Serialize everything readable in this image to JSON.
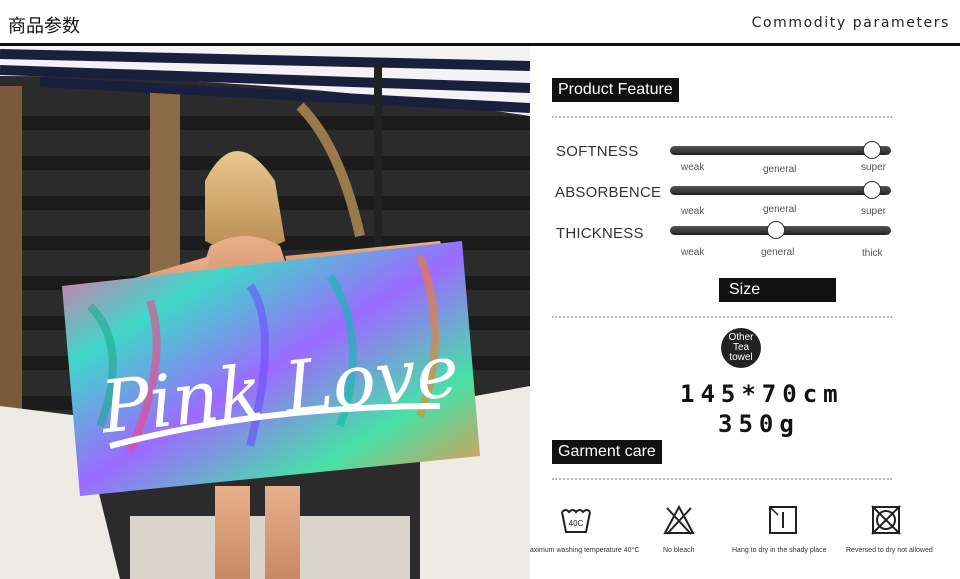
{
  "header": {
    "title_cn": "商品参数",
    "title_en": "Commodity parameters"
  },
  "photo": {
    "towel_text": "Pink Love",
    "description_icon": "beach-towel-photo"
  },
  "product_feature": {
    "heading": "Product Feature",
    "params": [
      {
        "label": "SOFTNESS",
        "ticks": [
          "weak",
          "general",
          "super"
        ],
        "level": 1.0
      },
      {
        "label": "ABSORBENCE",
        "ticks": [
          "weak",
          "general",
          "super"
        ],
        "level": 1.0
      },
      {
        "label": "THICKNESS",
        "ticks": [
          "weak",
          "general",
          "thick"
        ],
        "level": 0.5
      }
    ]
  },
  "size": {
    "heading": "Size",
    "badge_lines": [
      "Other",
      "Tea",
      "towel"
    ],
    "dimensions": "145*70cm",
    "weight": "350g"
  },
  "garment_care": {
    "heading": "Garment care",
    "items": [
      {
        "icon": "wash-40-icon",
        "label": "aximum washing temperature 40°C"
      },
      {
        "icon": "no-bleach-icon",
        "label": "No bleach"
      },
      {
        "icon": "dry-in-shade-icon",
        "label": "Hang to dry in the shady place"
      },
      {
        "icon": "no-tumble-dry-icon",
        "label": "Reversed to dry not allowed"
      }
    ]
  }
}
